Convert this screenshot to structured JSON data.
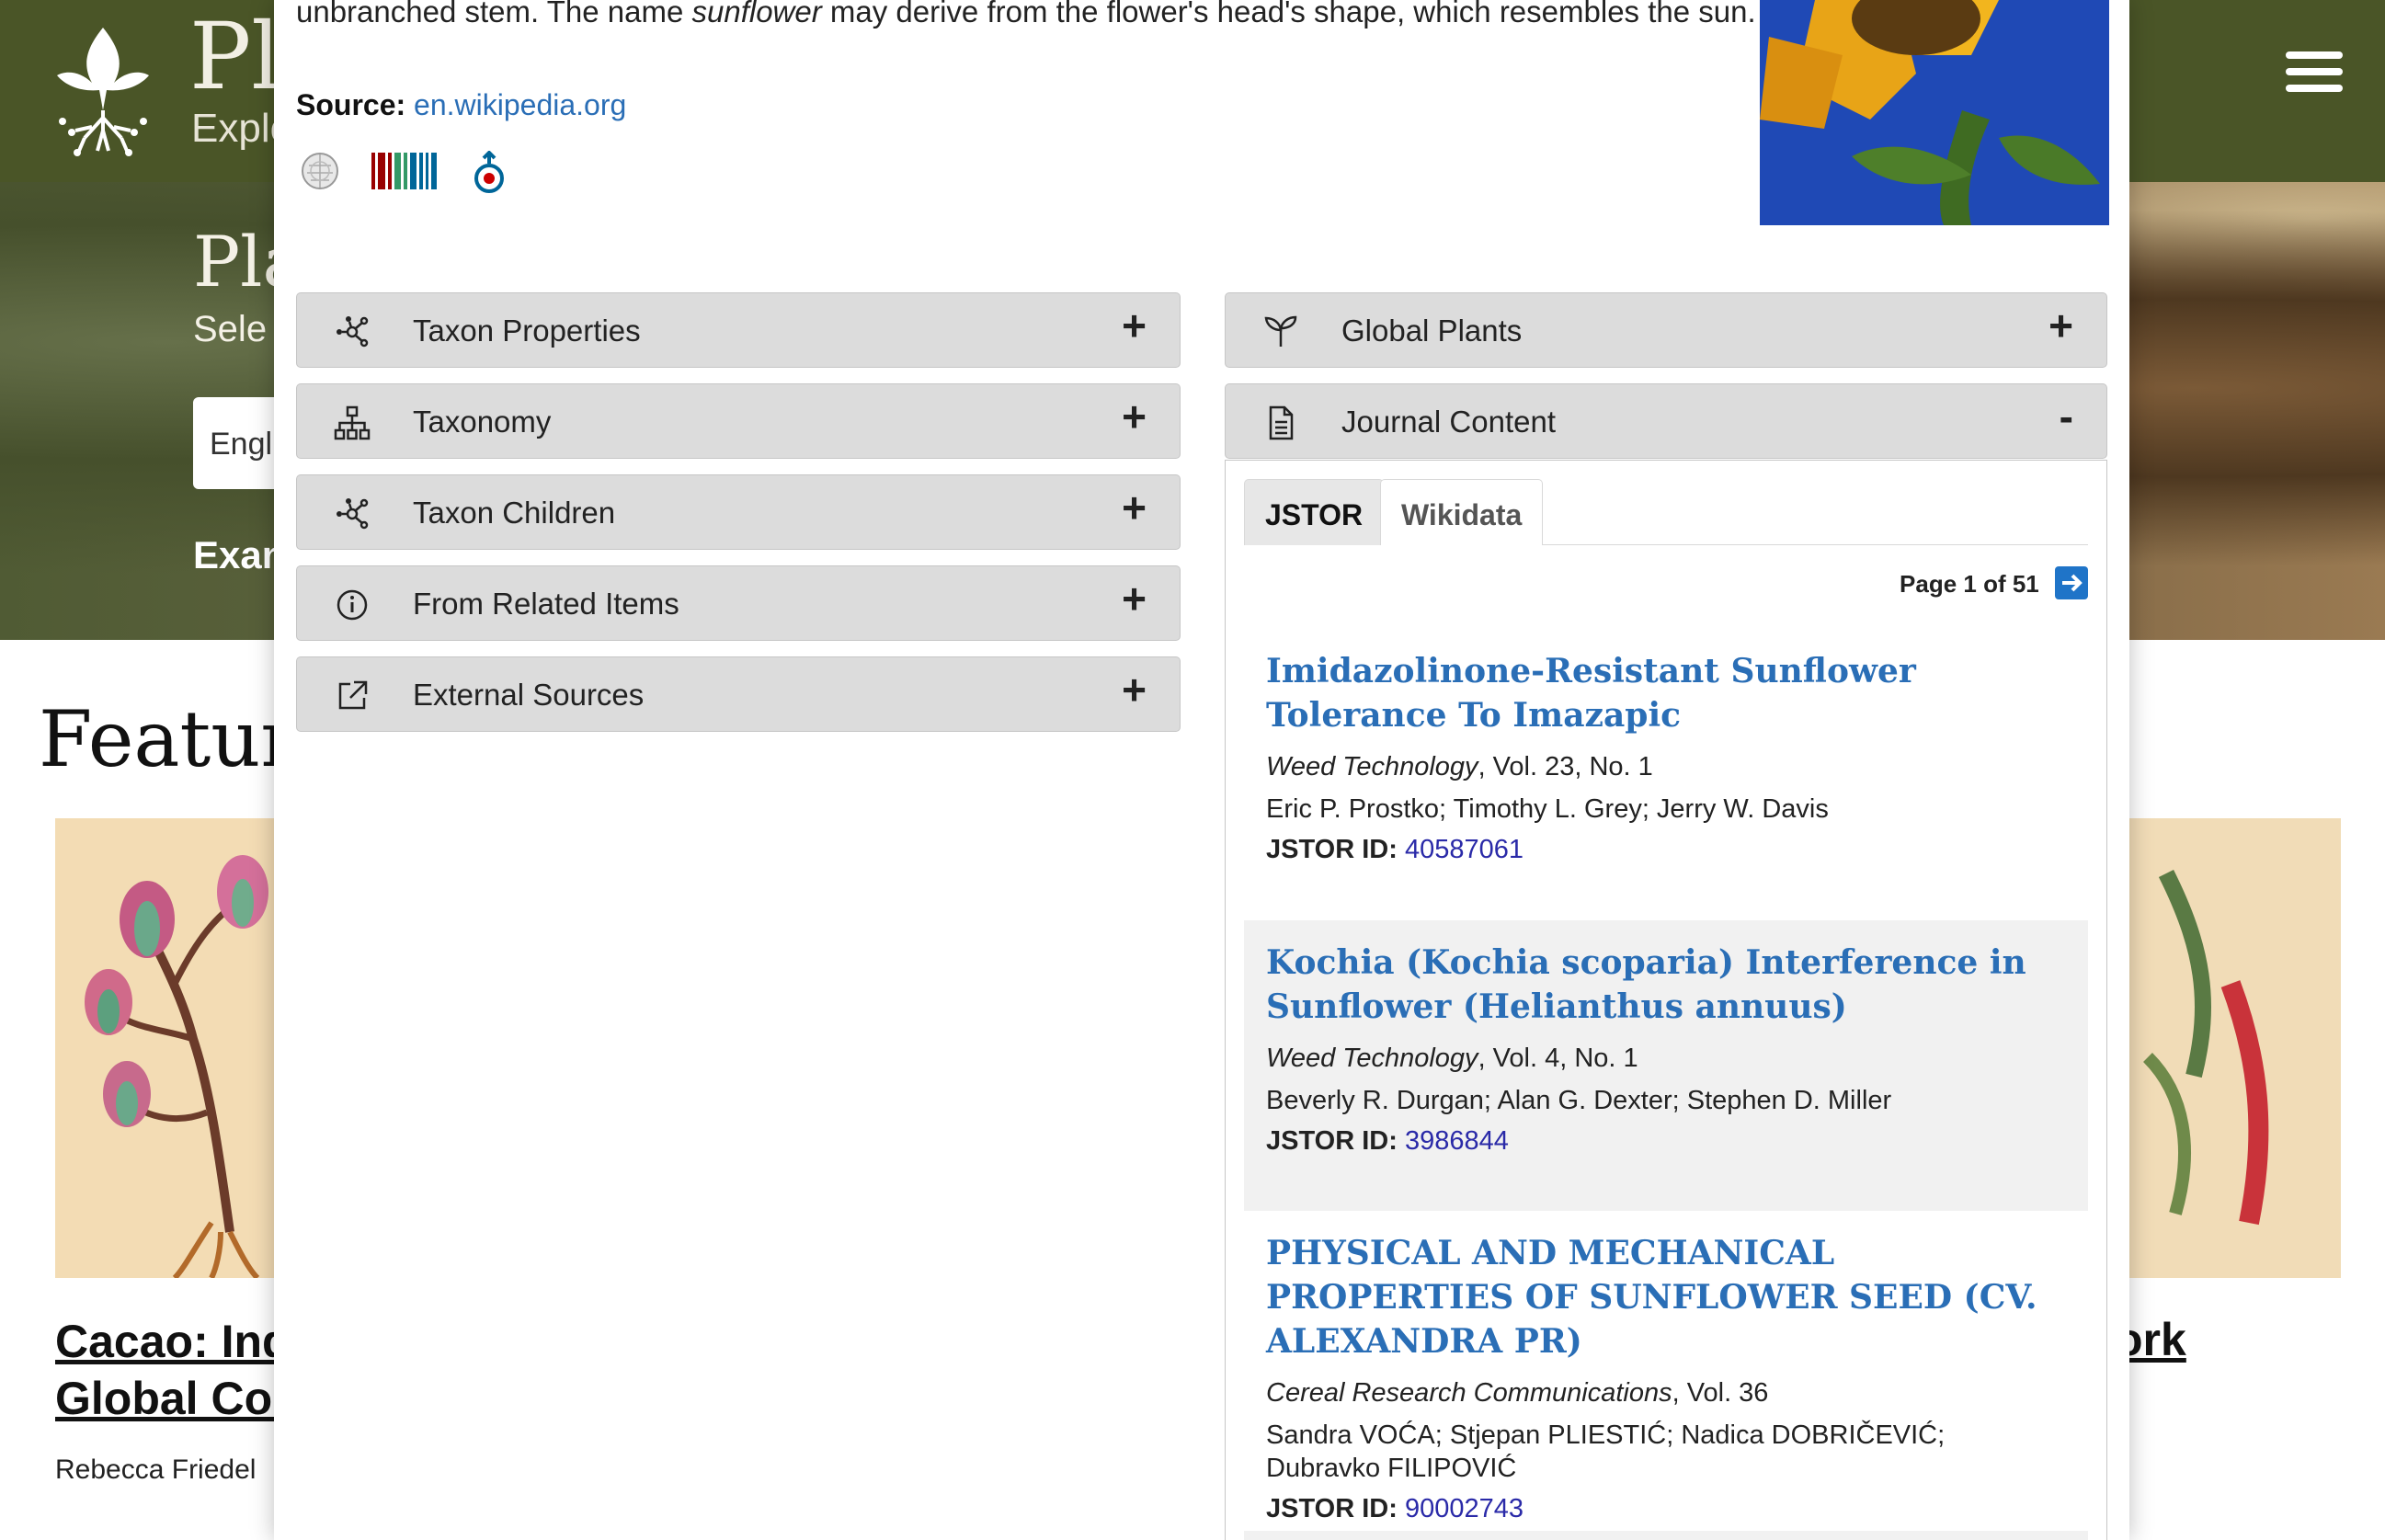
{
  "background": {
    "brand_title": "Pl",
    "brand_subtitle": "Explo",
    "hero_title": "Pla",
    "hero_subtitle": "Sele",
    "language_value": "Engli",
    "hero_example": "Exan",
    "featured_heading": "Feature",
    "left_card": {
      "title_line1": "Cacao: Indi",
      "title_line2": "Global Com",
      "author": "Rebecca Friedel"
    },
    "right_card": {
      "title_fragment": "ork"
    }
  },
  "modal": {
    "description_line1": "unbranched stem. The name ",
    "description_emphasis": "sunflower",
    "description_line2": " may derive from the flower's head's shape, which resembles the sun.",
    "source_label": "Source:",
    "source_link": "en.wikipedia.org",
    "external_icons": [
      "wikipedia-icon",
      "wikidata-icon",
      "wikimedia-commons-icon"
    ],
    "left_accordions": [
      {
        "label": "Taxon Properties",
        "icon": "network-icon",
        "toggle": "+"
      },
      {
        "label": "Taxonomy",
        "icon": "hierarchy-icon",
        "toggle": "+"
      },
      {
        "label": "Taxon Children",
        "icon": "network-icon",
        "toggle": "+"
      },
      {
        "label": "From Related Items",
        "icon": "info-icon",
        "toggle": "+"
      },
      {
        "label": "External Sources",
        "icon": "external-link-icon",
        "toggle": "+"
      }
    ],
    "right_accordions": [
      {
        "label": "Global Plants",
        "icon": "sprout-icon",
        "toggle": "+"
      },
      {
        "label": "Journal Content",
        "icon": "document-icon",
        "toggle": "-"
      }
    ],
    "tabs": [
      "JSTOR",
      "Wikidata"
    ],
    "active_tab": "JSTOR",
    "pager": "Page 1 of 51",
    "articles": [
      {
        "title": "Imidazolinone-Resistant Sunflower Tolerance To Imazapic",
        "journal": "Weed Technology",
        "issue": ", Vol. 23, No. 1",
        "authors": "Eric P. Prostko; Timothy L. Grey; Jerry W. Davis",
        "id_label": "JSTOR ID:",
        "id": "40587061"
      },
      {
        "title": "Kochia (Kochia scoparia) Interference in Sunflower (Helianthus annuus)",
        "journal": "Weed Technology",
        "issue": ", Vol. 4, No. 1",
        "authors": "Beverly R. Durgan; Alan G. Dexter; Stephen D. Miller",
        "id_label": "JSTOR ID:",
        "id": "3986844"
      },
      {
        "title": "PHYSICAL AND MECHANICAL PROPERTIES OF SUNFLOWER SEED (CV. ALEXANDRA PR)",
        "journal": "Cereal Research Communications",
        "issue": ", Vol. 36",
        "authors": "Sandra VOĆA; Stjepan PLIESTIĆ; Nadica DOBRIČEVIĆ; Dubravko FILIPOVIĆ",
        "id_label": "JSTOR ID:",
        "id": "90002743"
      }
    ]
  },
  "colors": {
    "header_green": "#4a5527",
    "link_blue": "#2a6eb6",
    "accordion_gray": "#dcdcdc",
    "pager_arrow": "#1f74c8"
  }
}
